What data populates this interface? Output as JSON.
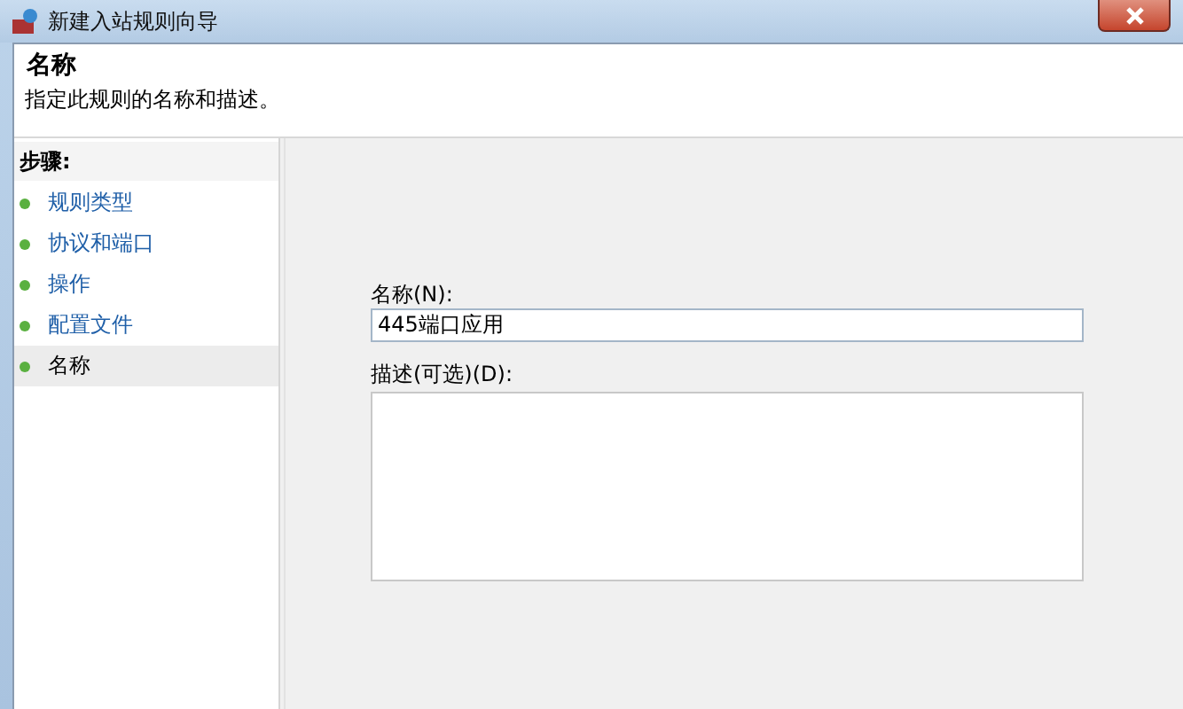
{
  "window": {
    "title": "新建入站规则向导"
  },
  "header": {
    "title": "名称",
    "subtitle": "指定此规则的名称和描述。"
  },
  "steps": {
    "heading": "步骤:",
    "items": [
      {
        "label": "规则类型",
        "selected": false
      },
      {
        "label": "协议和端口",
        "selected": false
      },
      {
        "label": "操作",
        "selected": false
      },
      {
        "label": "配置文件",
        "selected": false
      },
      {
        "label": "名称",
        "selected": true
      }
    ]
  },
  "form": {
    "name_label": "名称(N):",
    "name_value": "445端口应用",
    "description_label": "描述(可选)(D):"
  }
}
